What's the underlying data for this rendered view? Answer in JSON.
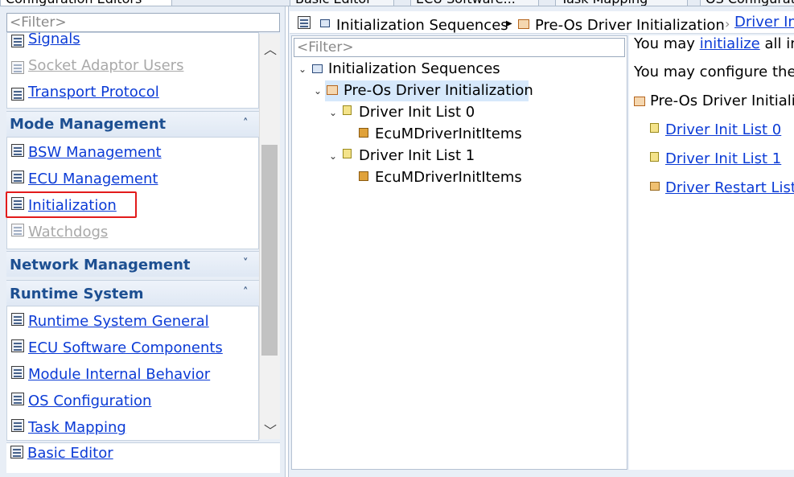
{
  "tabs": [
    {
      "label": "Configuration Editors",
      "active": true
    },
    {
      "label": "Basic Editor",
      "active": false
    },
    {
      "label": "ECU Software...",
      "active": false
    },
    {
      "label": "Task Mapping",
      "active": false
    },
    {
      "label": "OS Configuration",
      "active": false
    }
  ],
  "left": {
    "filter_placeholder": "<Filter>",
    "top_items": [
      {
        "label": "Signals",
        "enabled": true
      },
      {
        "label": "Socket Adaptor Users",
        "enabled": false
      },
      {
        "label": "Transport Protocol",
        "enabled": true
      }
    ],
    "groups": [
      {
        "title": "Mode Management",
        "expanded": true,
        "items": [
          {
            "label": "BSW Management",
            "enabled": true
          },
          {
            "label": "ECU Management",
            "enabled": true
          },
          {
            "label": "Initialization",
            "enabled": true,
            "highlighted": true
          },
          {
            "label": "Watchdogs",
            "enabled": false
          }
        ]
      },
      {
        "title": "Network Management",
        "expanded": false,
        "items": []
      },
      {
        "title": "Runtime System",
        "expanded": true,
        "items": [
          {
            "label": "Runtime System General",
            "enabled": true
          },
          {
            "label": "ECU Software Components",
            "enabled": true
          },
          {
            "label": "Module Internal Behavior",
            "enabled": true
          },
          {
            "label": "OS Configuration",
            "enabled": true
          },
          {
            "label": "Task Mapping",
            "enabled": true
          }
        ]
      }
    ],
    "bottom_item": {
      "label": "Basic Editor"
    }
  },
  "breadcrumb": {
    "items": [
      "Initialization Sequences",
      "Pre-Os Driver Initialization",
      "Driver In"
    ]
  },
  "tree": {
    "filter_placeholder": "<Filter>",
    "nodes": [
      {
        "label": "Initialization Sequences",
        "level": 0,
        "expanded": true
      },
      {
        "label": "Pre-Os Driver Initialization",
        "level": 1,
        "expanded": true,
        "selected": true
      },
      {
        "label": "Driver Init List 0",
        "level": 2,
        "expanded": true
      },
      {
        "label": "EcuMDriverInitItems",
        "level": 3
      },
      {
        "label": "Driver Init List 1",
        "level": 2,
        "expanded": true
      },
      {
        "label": "EcuMDriverInitItems",
        "level": 3
      }
    ]
  },
  "detail": {
    "line1_prefix": "You may ",
    "line1_link": "initialize",
    "line1_suffix": " all in",
    "line2": "You may configure the",
    "section_title": "Pre-Os Driver Initializ",
    "links": [
      "Driver Init List 0",
      "Driver Init List 1",
      "Driver Restart List"
    ]
  },
  "icons": [
    "dropdown-chevron-icon",
    "collapse-chevron-icon",
    "expand-chevron-icon",
    "scroll-up-icon",
    "scroll-down-icon",
    "tree-expand-icon",
    "breadcrumb-separator-icon"
  ],
  "colors": {
    "link": "#0b3bd6",
    "group_title": "#1d4f91",
    "highlight": "#e21b1b",
    "selection": "#d6e8fb"
  }
}
